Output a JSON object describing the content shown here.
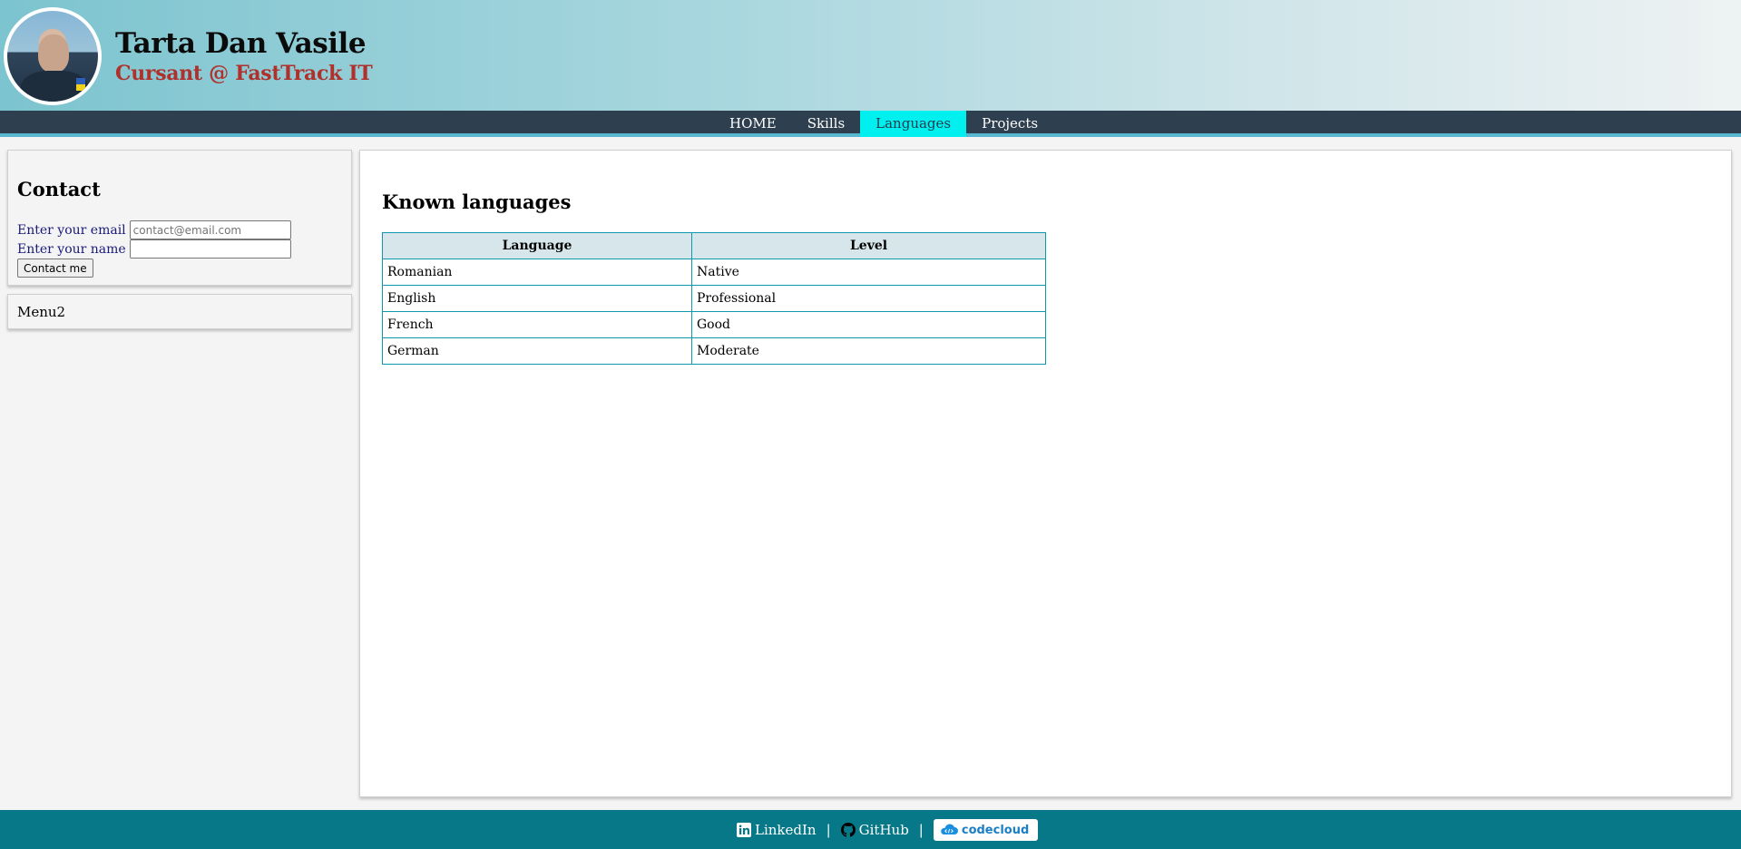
{
  "header": {
    "name": "Tarta Dan Vasile",
    "subtitle": "Cursant @ FastTrack IT",
    "avatar_icon": "profile-photo"
  },
  "nav": {
    "items": [
      {
        "label": "HOME",
        "active": false
      },
      {
        "label": "Skills",
        "active": false
      },
      {
        "label": "Languages",
        "active": true
      },
      {
        "label": "Projects",
        "active": false
      }
    ],
    "active_color": "#00f0f0",
    "background_color": "#2e3f4f"
  },
  "sidebar": {
    "contact": {
      "title": "Contact",
      "email_label": "Enter your email",
      "email_placeholder": "contact@email.com",
      "email_value": "",
      "name_label": "Enter your name",
      "name_value": "",
      "button_label": "Contact me"
    },
    "menu2": {
      "label": "Menu2"
    }
  },
  "main": {
    "title": "Known languages",
    "table": {
      "headers": [
        "Language",
        "Level"
      ],
      "rows": [
        [
          "Romanian",
          "Native"
        ],
        [
          "English",
          "Professional"
        ],
        [
          "French",
          "Good"
        ],
        [
          "German",
          "Moderate"
        ]
      ]
    }
  },
  "footer": {
    "links": [
      {
        "label": "LinkedIn",
        "icon": "linkedin-icon"
      },
      {
        "label": "GitHub",
        "icon": "github-icon"
      }
    ],
    "separator": "|",
    "codecloud_label": "codecloud",
    "background_color": "#067888"
  }
}
